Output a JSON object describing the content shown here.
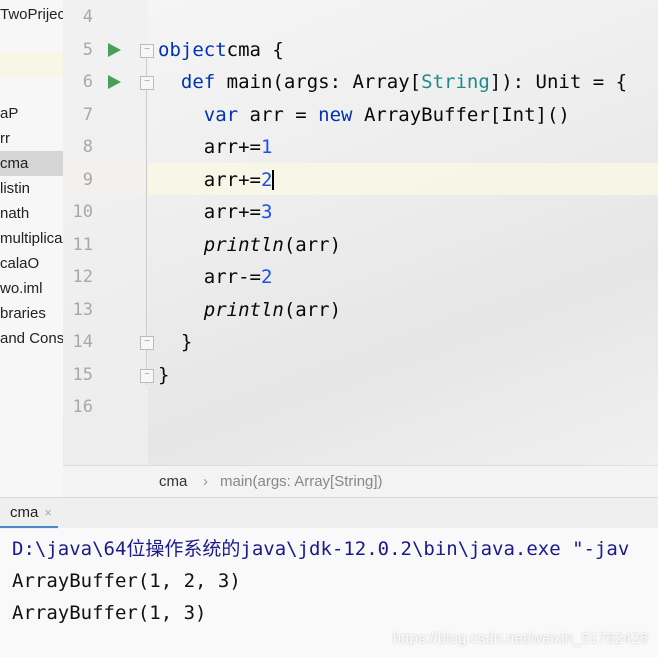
{
  "sidebar": {
    "items": [
      "TwoPrijec",
      "",
      "aP",
      "rr",
      "cma",
      "listin",
      "nath",
      "multiplica",
      "calaO",
      "wo.iml",
      "braries",
      "and Cons"
    ],
    "selected": "cma"
  },
  "editor": {
    "line_numbers": [
      "4",
      "5",
      "6",
      "7",
      "8",
      "9",
      "10",
      "11",
      "12",
      "13",
      "14",
      "15",
      "16"
    ],
    "lines": [
      [],
      [
        [
          "kw",
          "object"
        ],
        [
          "",
          "cma {"
        ]
      ],
      [
        [
          "",
          "  "
        ],
        [
          "kw",
          "def "
        ],
        [
          "",
          "main(args: Array["
        ],
        [
          "ty",
          "String"
        ],
        [
          "",
          "]): Unit = {"
        ]
      ],
      [
        [
          "",
          "    "
        ],
        [
          "kw",
          "var "
        ],
        [
          "",
          "arr = "
        ],
        [
          "kw",
          "new "
        ],
        [
          "",
          "ArrayBuffer[Int]()"
        ]
      ],
      [
        [
          "",
          "    arr+="
        ],
        [
          "num",
          "1"
        ]
      ],
      [
        [
          "",
          "    arr+="
        ],
        [
          "num",
          "2"
        ]
      ],
      [
        [
          "",
          "    arr+="
        ],
        [
          "num",
          "3"
        ]
      ],
      [
        [
          "",
          "    "
        ],
        [
          "it",
          "println"
        ],
        [
          "",
          "(arr)"
        ]
      ],
      [
        [
          "",
          "    arr-="
        ],
        [
          "num",
          "2"
        ]
      ],
      [
        [
          "",
          "    "
        ],
        [
          "it",
          "println"
        ],
        [
          "",
          "(arr)"
        ]
      ],
      [
        [
          "",
          "  }"
        ]
      ],
      [
        [
          "",
          "}"
        ]
      ],
      []
    ]
  },
  "breadcrumb": {
    "items": [
      "cma",
      "main(args: Array[String])"
    ],
    "sep": "›"
  },
  "run_tab": {
    "label": "cma",
    "close": "×"
  },
  "console": {
    "lines": [
      "D:\\java\\64位操作系统的java\\jdk-12.0.2\\bin\\java.exe \"-jav",
      "ArrayBuffer(1, 2, 3)",
      "ArrayBuffer(1, 3)"
    ]
  },
  "watermark": "https://blog.csdn.net/weixin_51762426",
  "colors": {
    "keyword": "#0033b3",
    "type": "#1a8c8c",
    "number": "#1750eb",
    "run": "#4a9e5c"
  }
}
